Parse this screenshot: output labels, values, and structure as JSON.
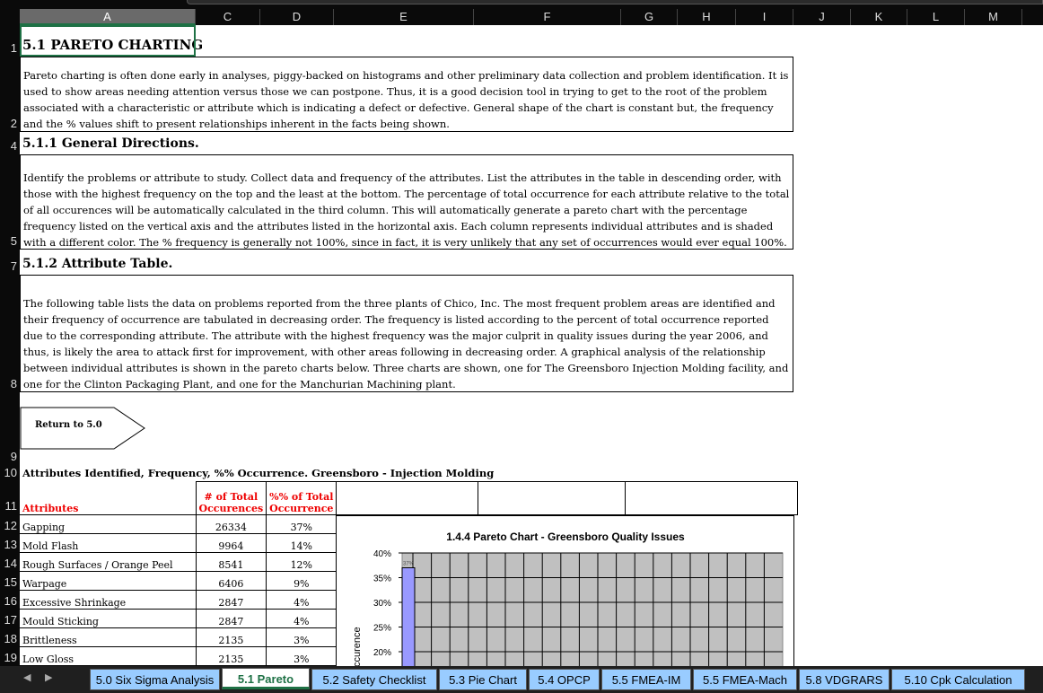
{
  "columns": [
    "A",
    "C",
    "D",
    "E",
    "F",
    "G",
    "H",
    "I",
    "J",
    "K",
    "L",
    "M"
  ],
  "rows": [
    "1",
    "2",
    "4",
    "5",
    "7",
    "8",
    "9",
    "10",
    "11",
    "12",
    "13",
    "14",
    "15",
    "16",
    "17",
    "18",
    "19"
  ],
  "title": "5.1 PARETO CHARTING",
  "intro": "Pareto charting is often done early in analyses, piggy-backed on histograms and other preliminary data collection and problem identification. It is used to show areas needing attention versus those we can postpone. Thus, it is a good decision tool in trying to get to the root of the problem associated with a characteristic or attribute which is indicating a defect or defective. General shape of the chart is constant but, the frequency and the % values shift to present relationships inherent in the facts being shown.",
  "section1": {
    "heading": "5.1.1 General Directions.",
    "text": "Identify the problems or attribute to study. Collect data and frequency of the attributes. List the attributes in the table in descending order, with those with the highest frequency on the top and the least at the bottom. The percentage of total occurrence for each attribute relative to the total of all occurences will be automatically calculated in the third column. This will automatically generate a pareto chart with the percentage frequency listed on the vertical axis and the attributes listed in the horizontal axis. Each column represents individual attributes and is shaded with a different color. The % frequency is generally not 100%, since in fact, it is very unlikely that any set of occurrences would ever equal 100%."
  },
  "section2": {
    "heading": "5.1.2 Attribute Table.",
    "text": "The following table lists the data on problems reported from the three plants of Chico, Inc.  The most frequent problem areas are identified and their frequency of occurrence are tabulated in decreasing order. The frequency is listed according to the percent of total occurrence reported due to the corresponding attribute. The attribute with the highest frequency was the major culprit in quality issues during the year 2006, and thus, is likely the area to attack first for improvement, with other areas following in decreasing order. A graphical analysis of the relationship between individual attributes is shown in the pareto charts below.  Three charts are shown, one for The Greensboro Injection Molding facility, and one for the Clinton Packaging Plant, and one for the Manchurian Machining plant."
  },
  "return_button": "Return to 5.0",
  "table": {
    "caption": "Attributes Identified, Frequency, %% Occurrence. Greensboro - Injection Molding",
    "headers": [
      "Attributes",
      "# of Total Occurences",
      "%% of Total Occurrence"
    ],
    "rows": [
      [
        "Gapping",
        "26334",
        "37%"
      ],
      [
        "Mold Flash",
        "9964",
        "14%"
      ],
      [
        "Rough Surfaces / Orange Peel",
        "8541",
        "12%"
      ],
      [
        "Warpage",
        "6406",
        "9%"
      ],
      [
        "Excessive Shrinkage",
        "2847",
        "4%"
      ],
      [
        "Mould Sticking",
        "2847",
        "4%"
      ],
      [
        "Brittleness",
        "2135",
        "3%"
      ],
      [
        "Low Gloss",
        "2135",
        "3%"
      ]
    ]
  },
  "chart_data": {
    "type": "bar",
    "title": "1.4.4 Pareto Chart - Greensboro Quality Issues",
    "ylabel": "Occurence",
    "ylim": [
      0,
      0.4
    ],
    "yticks": [
      "40%",
      "35%",
      "30%",
      "25%",
      "20%"
    ],
    "visible_values": [
      0.37
    ],
    "data_labels": [
      "37%"
    ],
    "bar_color": "#9999ff",
    "plot_bg": "#c0c0c0",
    "grid": true
  },
  "tabs": [
    "5.0 Six Sigma Analysis",
    "5.1 Pareto",
    "5.2 Safety Checklist",
    "5.3 Pie Chart",
    "5.4 OPCP",
    "5.5 FMEA-IM",
    "5.5 FMEA-Mach",
    "5.8 VDGRARS",
    "5.10 Cpk Calculation"
  ],
  "active_tab": "5.1 Pareto"
}
